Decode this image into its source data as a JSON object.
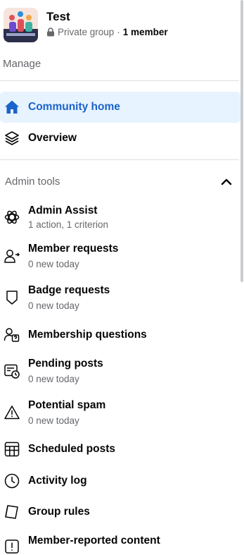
{
  "group": {
    "name": "Test",
    "privacy": "Private group",
    "separator": "·",
    "members": "1 member"
  },
  "manage": {
    "label": "Manage",
    "items": [
      {
        "label": "Community home",
        "icon": "home-icon",
        "active": true
      },
      {
        "label": "Overview",
        "icon": "layers-icon",
        "active": false
      }
    ]
  },
  "admin_tools": {
    "label": "Admin tools",
    "expanded": true,
    "items": [
      {
        "label": "Admin Assist",
        "sub": "1 action, 1 criterion",
        "icon": "admin-assist-icon"
      },
      {
        "label": "Member requests",
        "sub": "0 new today",
        "icon": "member-request-icon"
      },
      {
        "label": "Badge requests",
        "sub": "0 new today",
        "icon": "badge-icon"
      },
      {
        "label": "Membership questions",
        "sub": "",
        "icon": "questions-icon"
      },
      {
        "label": "Pending posts",
        "sub": "0 new today",
        "icon": "pending-posts-icon"
      },
      {
        "label": "Potential spam",
        "sub": "0 new today",
        "icon": "warning-icon"
      },
      {
        "label": "Scheduled posts",
        "sub": "",
        "icon": "calendar-grid-icon"
      },
      {
        "label": "Activity log",
        "sub": "",
        "icon": "clock-icon"
      },
      {
        "label": "Group rules",
        "sub": "",
        "icon": "rules-book-icon"
      },
      {
        "label": "Member-reported content",
        "sub": "",
        "icon": "report-icon"
      }
    ]
  },
  "colors": {
    "accent": "#1a63c8",
    "active_bg": "#e7f3ff",
    "secondary_text": "#65676b",
    "divider": "#dcdfe3"
  }
}
